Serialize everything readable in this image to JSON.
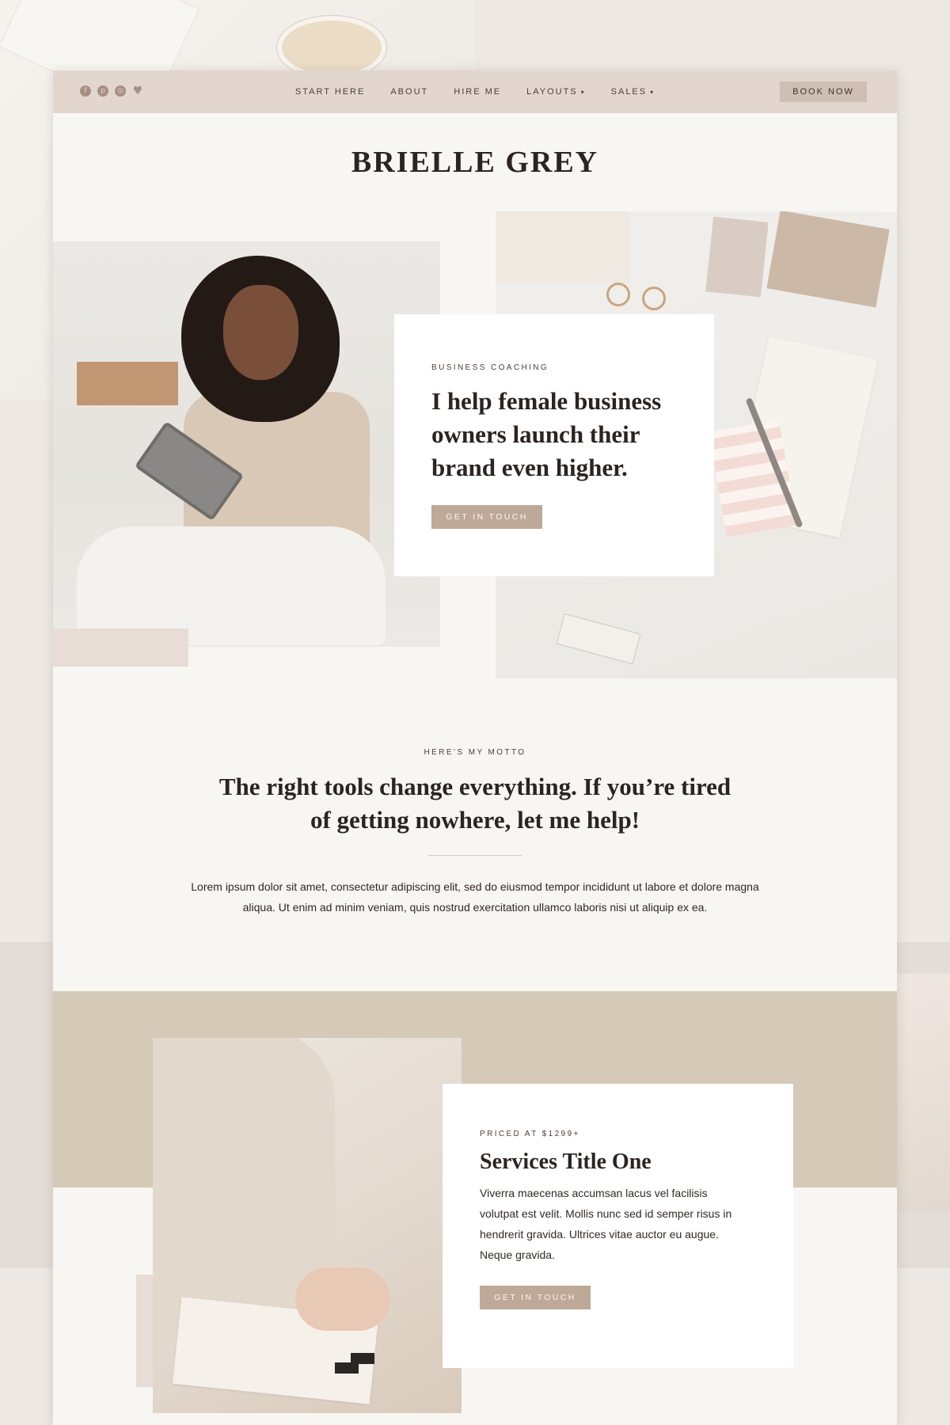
{
  "nav": {
    "items": [
      {
        "label": "START HERE",
        "dropdown": false
      },
      {
        "label": "ABOUT",
        "dropdown": false
      },
      {
        "label": "HIRE ME",
        "dropdown": false
      },
      {
        "label": "LAYOUTS",
        "dropdown": true
      },
      {
        "label": "SALES",
        "dropdown": true
      }
    ],
    "book_label": "BOOK NOW",
    "social_icons": [
      "facebook-icon",
      "pinterest-icon",
      "instagram-icon",
      "heart-icon"
    ]
  },
  "brand": {
    "title": "BRIELLE GREY"
  },
  "hero": {
    "eyebrow": "BUSINESS COACHING",
    "heading_lines": [
      "I help female business",
      "owners launch their",
      "brand even higher."
    ],
    "cta": "GET IN TOUCH"
  },
  "motto": {
    "eyebrow": "HERE’S MY MOTTO",
    "heading_lines": [
      "The right tools change everything. If you’re tired",
      "of getting nowhere, let me help!"
    ],
    "text_lines": [
      "Lorem ipsum dolor sit amet, consectetur adipiscing elit, sed do eiusmod tempor incididunt ut labore et dolore magna",
      "aliqua. Ut enim ad minim veniam, quis nostrud exercitation ullamco laboris nisi ut aliquip ex ea."
    ]
  },
  "services": {
    "eyebrow": "PRICED AT $1299+",
    "title": "Services Title One",
    "text_lines": [
      "Viverra maecenas accumsan lacus vel facilisis",
      "volutpat est velit. Mollis nunc sed id semper risus in",
      "hendrerit gravida. Ultrices vitae auctor eu augue.",
      "Neque gravida."
    ],
    "cta": "GET IN TOUCH"
  },
  "colors": {
    "topbar": "#e2d6cf",
    "accent_button": "#bea897",
    "services_band": "#d5cab8",
    "page_bg": "#f8f6f2"
  }
}
